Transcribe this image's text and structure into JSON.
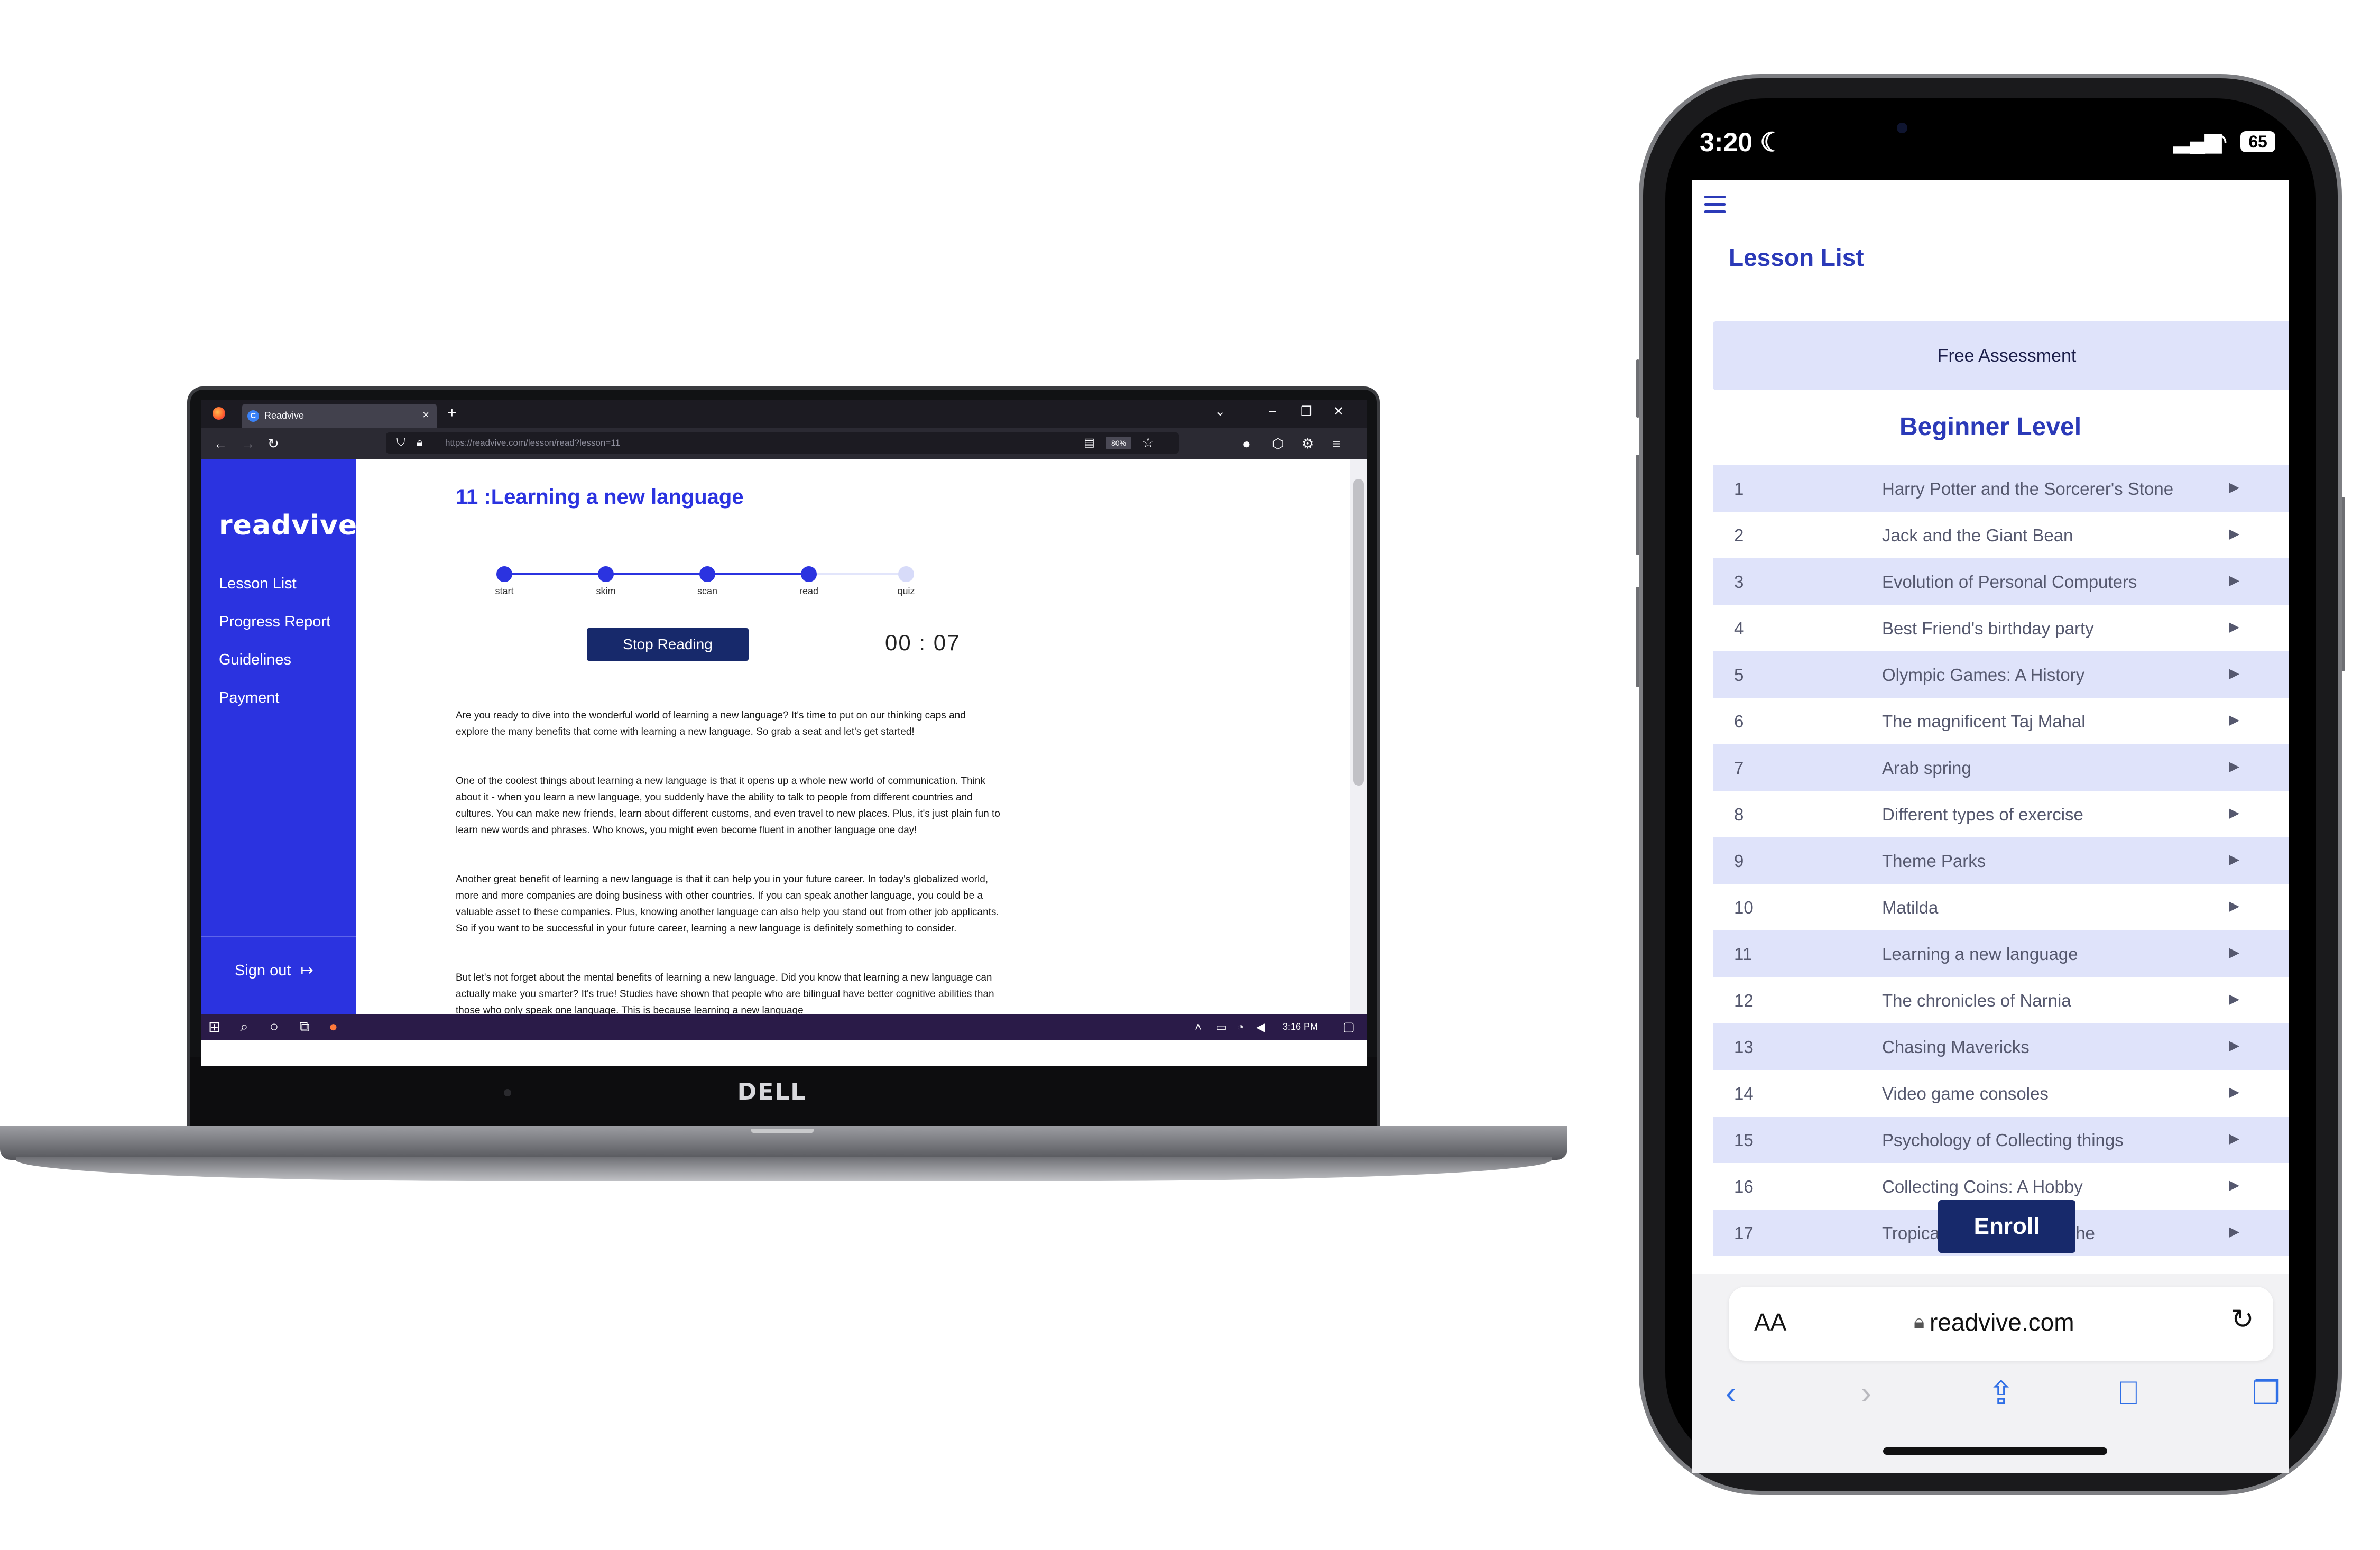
{
  "laptop": {
    "browser": {
      "tab_title": "Readvive",
      "tab_close": "×",
      "new_tab": "+",
      "url": "https://readvive.com/lesson/read?lesson=11",
      "zoom": "80%"
    },
    "sidebar": {
      "brand": "readvive",
      "items": [
        {
          "label": "Lesson List"
        },
        {
          "label": "Progress Report"
        },
        {
          "label": "Guidelines"
        },
        {
          "label": "Payment"
        }
      ],
      "signout": "Sign out"
    },
    "lesson": {
      "title": "11 :Learning a new language",
      "steps": [
        "start",
        "skim",
        "scan",
        "read",
        "quiz"
      ],
      "completed_steps": 4,
      "stop_button": "Stop Reading",
      "timer": "00 : 07",
      "paragraphs": [
        "Are you ready to dive into the wonderful world of learning a new language? It's time to put on our thinking caps and explore the many benefits that come with learning a new language. So grab a seat and let's get started!",
        "One of the coolest things about learning a new language is that it opens up a whole new world of communication. Think about it - when you learn a new language, you suddenly have the ability to talk to people from different countries and cultures. You can make new friends, learn about different customs, and even travel to new places. Plus, it's just plain fun to learn new words and phrases. Who knows, you might even become fluent in another language one day!",
        "Another great benefit of learning a new language is that it can help you in your future career. In today's globalized world, more and more companies are doing business with other countries. If you can speak another language, you could be a valuable asset to these companies. Plus, knowing another language can also help you stand out from other job applicants. So if you want to be successful in your future career, learning a new language is definitely something to consider.",
        "But let's not forget about the mental benefits of learning a new language. Did you know that learning a new language can actually make you smarter? It's true! Studies have shown that people who are bilingual have better cognitive abilities than those who only speak one language. This is because learning a new language"
      ]
    },
    "taskbar": {
      "time": "3:16 PM"
    },
    "device_logo": "DELL"
  },
  "phone": {
    "status": {
      "time": "3:20",
      "battery": "65"
    },
    "page": {
      "title": "Lesson List",
      "assessment_button": "Free Assessment",
      "level": "Beginner Level",
      "lessons": [
        {
          "num": "1",
          "name": "Harry Potter and the Sorcerer's Stone"
        },
        {
          "num": "2",
          "name": "Jack and the Giant Bean"
        },
        {
          "num": "3",
          "name": "Evolution of Personal Computers"
        },
        {
          "num": "4",
          "name": "Best Friend's birthday party"
        },
        {
          "num": "5",
          "name": "Olympic Games: A History"
        },
        {
          "num": "6",
          "name": "The magnificent Taj Mahal"
        },
        {
          "num": "7",
          "name": "Arab spring"
        },
        {
          "num": "8",
          "name": "Different types of exercise"
        },
        {
          "num": "9",
          "name": "Theme Parks"
        },
        {
          "num": "10",
          "name": "Matilda"
        },
        {
          "num": "11",
          "name": "Learning a new language"
        },
        {
          "num": "12",
          "name": "The chronicles of Narnia"
        },
        {
          "num": "13",
          "name": "Chasing Mavericks"
        },
        {
          "num": "14",
          "name": "Video game consoles"
        },
        {
          "num": "15",
          "name": "Psychology of Collecting things"
        },
        {
          "num": "16",
          "name": "Collecting Coins: A Hobby"
        },
        {
          "num": "17",
          "name": "Tropical ... that Threats The"
        }
      ],
      "enroll_button": "Enroll"
    },
    "safari": {
      "aa": "AA",
      "address": "readvive.com"
    }
  },
  "colors": {
    "brand_blue": "#2b33e0",
    "navy": "#17296b",
    "row_tint": "#dfe3fa"
  }
}
